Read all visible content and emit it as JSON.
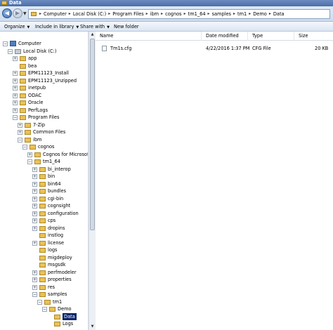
{
  "window": {
    "title": "Data"
  },
  "address": {
    "path": [
      "Computer",
      "Local Disk (C:)",
      "Program Files",
      "ibm",
      "cognos",
      "tm1_64",
      "samples",
      "tm1",
      "Demo",
      "Data"
    ]
  },
  "toolbar": {
    "organize": "Organize",
    "include_in_library": "Include in library",
    "share_with": "Share with",
    "new_folder": "New folder"
  },
  "tree": [
    {
      "label": "Computer",
      "icon": "computer-icon",
      "expanded": true
    },
    {
      "label": "Local Disk (C:)",
      "icon": "drive-icon",
      "expanded": true
    },
    {
      "label": "app",
      "icon": "folder-icon",
      "expanded": false
    },
    {
      "label": "bea",
      "icon": "folder-icon",
      "expanded": null
    },
    {
      "label": "EPM11123_Install",
      "icon": "folder-icon",
      "expanded": false
    },
    {
      "label": "EPM11123_Unzipped",
      "icon": "folder-icon",
      "expanded": false
    },
    {
      "label": "inetpub",
      "icon": "folder-icon",
      "expanded": false
    },
    {
      "label": "ODAC",
      "icon": "folder-icon",
      "expanded": false
    },
    {
      "label": "Oracle",
      "icon": "folder-icon",
      "expanded": false
    },
    {
      "label": "PerfLogs",
      "icon": "folder-icon",
      "expanded": false
    },
    {
      "label": "Program Files",
      "icon": "folder-icon",
      "expanded": true
    },
    {
      "label": "7-Zip",
      "icon": "folder-icon",
      "expanded": false
    },
    {
      "label": "Common Files",
      "icon": "folder-icon",
      "expanded": false
    },
    {
      "label": "ibm",
      "icon": "folder-icon",
      "expanded": true
    },
    {
      "label": "cognos",
      "icon": "folder-icon",
      "expanded": true
    },
    {
      "label": "Cognos for Microsoft Office",
      "icon": "folder-icon",
      "expanded": false
    },
    {
      "label": "tm1_64",
      "icon": "folder-icon",
      "expanded": true
    },
    {
      "label": "bi_interop",
      "icon": "folder-icon",
      "expanded": false
    },
    {
      "label": "bin",
      "icon": "folder-icon",
      "expanded": false
    },
    {
      "label": "bin64",
      "icon": "folder-icon",
      "expanded": false
    },
    {
      "label": "bundles",
      "icon": "folder-icon",
      "expanded": false
    },
    {
      "label": "cgi-bin",
      "icon": "folder-icon",
      "expanded": false
    },
    {
      "label": "cognsight",
      "icon": "folder-icon",
      "expanded": false
    },
    {
      "label": "configuration",
      "icon": "folder-icon",
      "expanded": false
    },
    {
      "label": "cps",
      "icon": "folder-icon",
      "expanded": false
    },
    {
      "label": "dropins",
      "icon": "folder-icon",
      "expanded": false
    },
    {
      "label": "instlog",
      "icon": "folder-icon",
      "expanded": null
    },
    {
      "label": "license",
      "icon": "folder-icon",
      "expanded": false
    },
    {
      "label": "logs",
      "icon": "folder-icon",
      "expanded": null
    },
    {
      "label": "migdeploy",
      "icon": "folder-icon",
      "expanded": null
    },
    {
      "label": "msgsdk",
      "icon": "folder-icon",
      "expanded": null
    },
    {
      "label": "perfmodeler",
      "icon": "folder-icon",
      "expanded": false
    },
    {
      "label": "properties",
      "icon": "folder-icon",
      "expanded": false
    },
    {
      "label": "res",
      "icon": "folder-icon",
      "expanded": false
    },
    {
      "label": "samples",
      "icon": "folder-icon",
      "expanded": true
    },
    {
      "label": "tm1",
      "icon": "folder-icon",
      "expanded": true
    },
    {
      "label": "Demo",
      "icon": "folder-icon",
      "expanded": true
    },
    {
      "label": "Data",
      "icon": "folder-icon",
      "expanded": null,
      "selected": true
    },
    {
      "label": "Logs",
      "icon": "folder-icon",
      "expanded": null
    }
  ],
  "columns": {
    "name": "Name",
    "date": "Date modified",
    "type": "Type",
    "size": "Size"
  },
  "files": [
    {
      "name": "Tm1s.cfg",
      "date": "4/22/2016 1:37 PM",
      "type": "CFG File",
      "size": "20 KB"
    }
  ],
  "colors": {
    "selection": "#0a246a",
    "titlebar": "#4a6ea8"
  }
}
